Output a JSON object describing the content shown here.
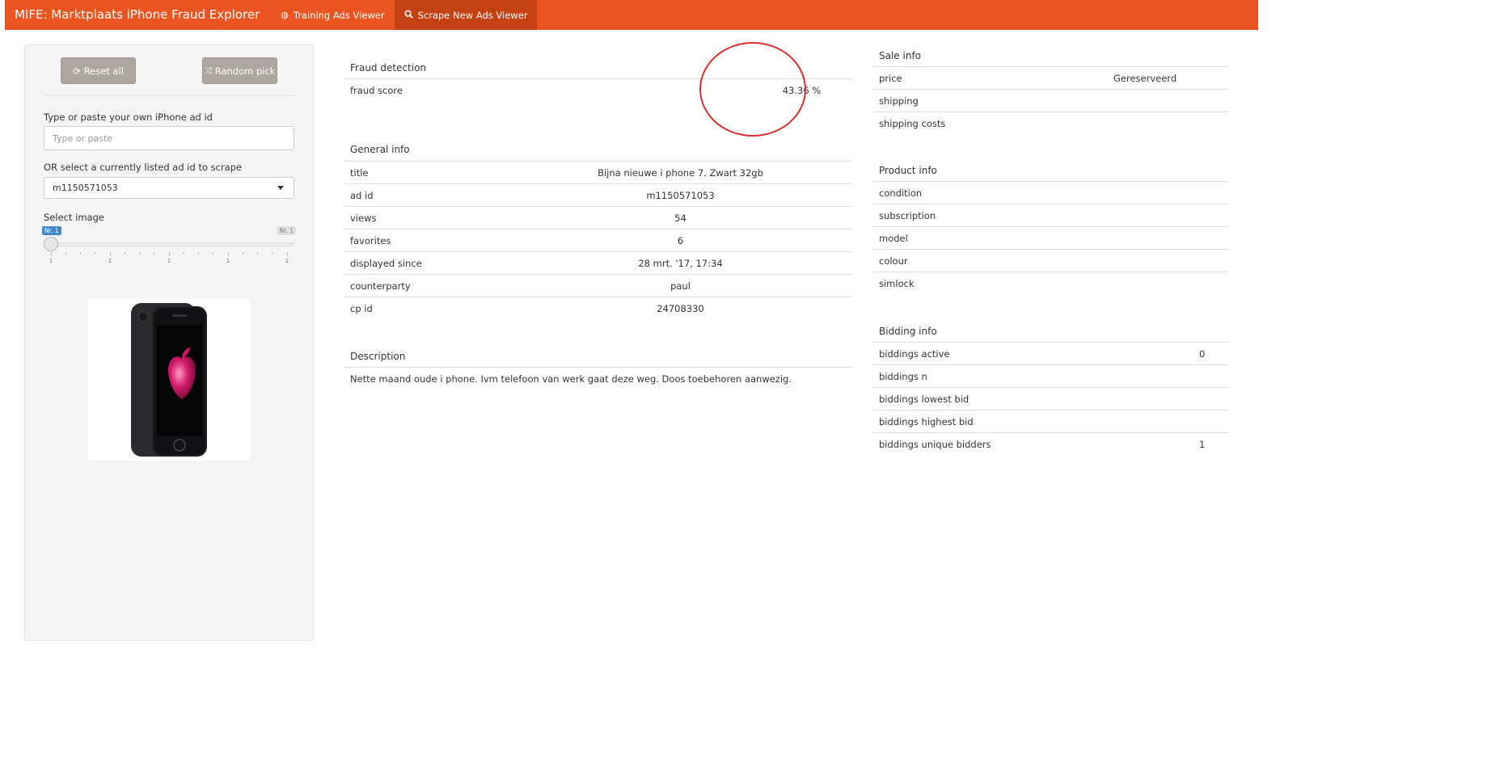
{
  "navbar": {
    "brand": "MIFE: Marktplaats iPhone Fraud Explorer",
    "tabs": [
      {
        "label": "Training Ads Viewer",
        "icon": "globe-icon",
        "active": false
      },
      {
        "label": "Scrape New Ads Viewer",
        "icon": "search-icon",
        "active": true
      }
    ],
    "color": "#e95420"
  },
  "sidebar": {
    "reset_label": "Reset all",
    "random_label": "Random pick",
    "own_id_label": "Type or paste your own iPhone ad id",
    "own_id_placeholder": "Type or paste",
    "own_id_value": "",
    "select_label": "OR select a currently listed ad id to scrape",
    "select_value": "m1150571053",
    "image_label": "Select image",
    "slider": {
      "current_badge": "Nr. 1",
      "max_badge": "Nr. 1",
      "tick_labels": [
        "1",
        "1",
        "1",
        "1",
        "1"
      ],
      "value_fraction": 0
    },
    "image_icon": "iphone-7-black-image"
  },
  "fraud": {
    "title": "Fraud detection",
    "rows": [
      {
        "label": "fraud score",
        "value": "43.36 %"
      }
    ]
  },
  "general": {
    "title": "General info",
    "rows": [
      {
        "label": "title",
        "value": "Bijna nieuwe i phone 7. Zwart 32gb"
      },
      {
        "label": "ad id",
        "value": "m1150571053"
      },
      {
        "label": "views",
        "value": "54"
      },
      {
        "label": "favorites",
        "value": "6"
      },
      {
        "label": "displayed since",
        "value": "28 mrt. '17, 17:34"
      },
      {
        "label": "counterparty",
        "value": "paul"
      },
      {
        "label": "cp id",
        "value": "24708330"
      }
    ]
  },
  "description": {
    "title": "Description",
    "text": "Nette maand oude i phone. Ivm telefoon van werk gaat deze weg. Doos toebehoren aanwezig."
  },
  "sale": {
    "title": "Sale info",
    "rows": [
      {
        "label": "price",
        "value": "Gereserveerd"
      },
      {
        "label": "shipping",
        "value": ""
      },
      {
        "label": "shipping costs",
        "value": ""
      }
    ]
  },
  "product": {
    "title": "Product info",
    "rows": [
      {
        "label": "condition",
        "value": ""
      },
      {
        "label": "subscription",
        "value": ""
      },
      {
        "label": "model",
        "value": ""
      },
      {
        "label": "colour",
        "value": ""
      },
      {
        "label": "simlock",
        "value": ""
      }
    ]
  },
  "bidding": {
    "title": "Bidding info",
    "rows": [
      {
        "label": "biddings active",
        "value": "0"
      },
      {
        "label": "biddings n",
        "value": ""
      },
      {
        "label": "biddings lowest bid",
        "value": ""
      },
      {
        "label": "biddings highest bid",
        "value": ""
      },
      {
        "label": "biddings unique bidders",
        "value": "1"
      }
    ]
  },
  "annotation": {
    "color": "#d62f2f"
  }
}
